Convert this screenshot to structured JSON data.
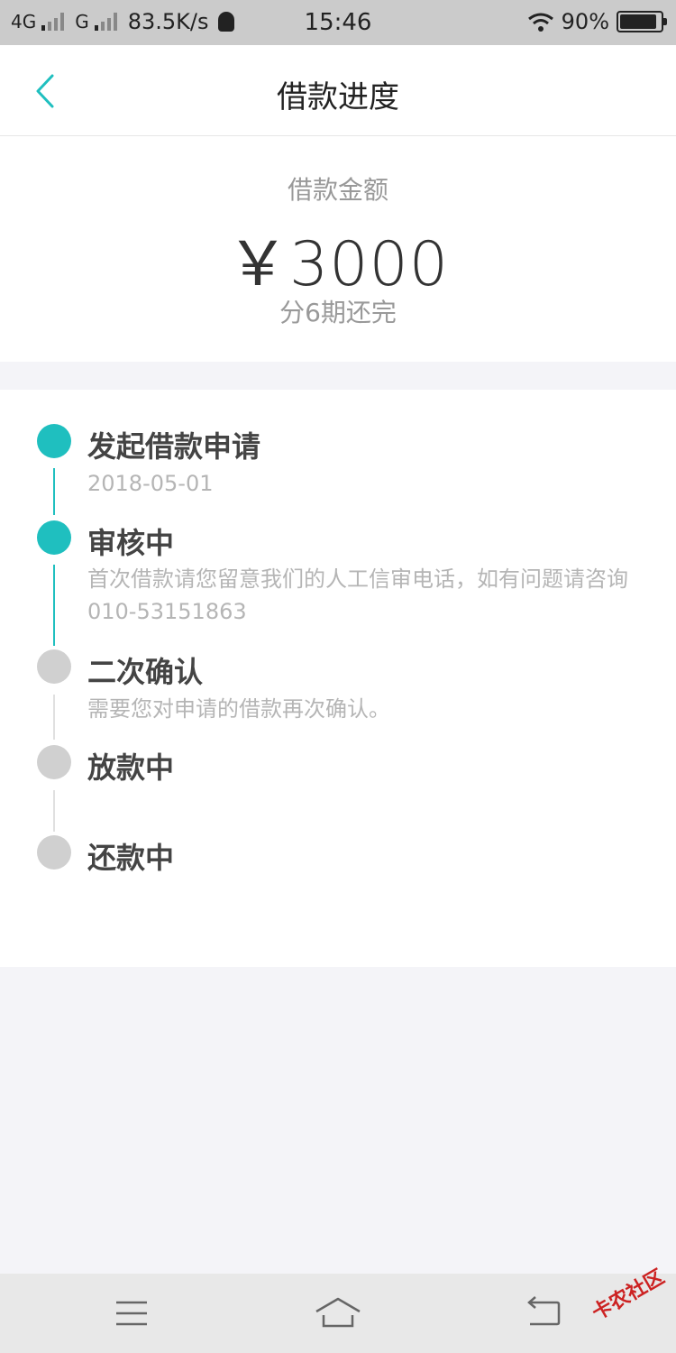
{
  "status_bar": {
    "net1": "4G",
    "net2": "G",
    "speed": "83.5K/s",
    "time": "15:46",
    "battery": "90%"
  },
  "nav": {
    "title": "借款进度"
  },
  "loan": {
    "label": "借款金额",
    "amount": "￥3000",
    "term": "分6期还完"
  },
  "steps": [
    {
      "title": "发起借款申请",
      "desc": "2018-05-01",
      "status": "done"
    },
    {
      "title": "审核中",
      "desc": "首次借款请您留意我们的人工信审电话，如有问题请咨询 010-53151863",
      "status": "done"
    },
    {
      "title": "二次确认",
      "desc": "需要您对申请的借款再次确认。",
      "status": "pending"
    },
    {
      "title": "放款中",
      "desc": "",
      "status": "pending"
    },
    {
      "title": "还款中",
      "desc": "",
      "status": "pending"
    }
  ],
  "watermark": "卡农社区",
  "colors": {
    "accent": "#1fbfbf",
    "inactive": "#d0d0d0",
    "background": "#f4f4f8"
  }
}
